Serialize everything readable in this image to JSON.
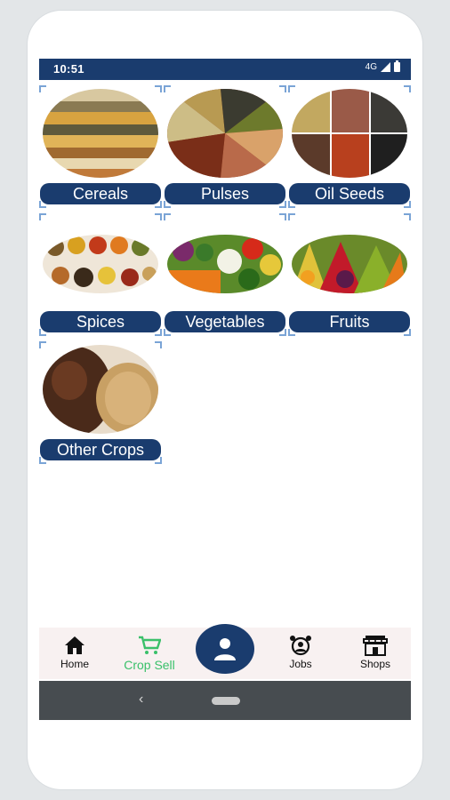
{
  "status": {
    "time": "10:51",
    "network": "4G"
  },
  "categories": [
    {
      "label": "Cereals",
      "image": "cereals-photo"
    },
    {
      "label": "Pulses",
      "image": "pulses-photo"
    },
    {
      "label": "Oil Seeds",
      "image": "oil-seeds-photo"
    },
    {
      "label": "Spices",
      "image": "spices-photo"
    },
    {
      "label": "Vegetables",
      "image": "vegetables-photo"
    },
    {
      "label": "Fruits",
      "image": "fruits-photo"
    },
    {
      "label": "Other Crops",
      "image": "other-crops-photo"
    }
  ],
  "nav": {
    "home": "Home",
    "crop_sell": "Crop Sell",
    "jobs": "Jobs",
    "shops": "Shops",
    "active": "crop_sell"
  },
  "colors": {
    "primary": "#1a3c6e",
    "active": "#3ac06a",
    "nav_bg": "#f8f1f1",
    "system_bar": "#474c50"
  },
  "icons": [
    "home-icon",
    "cart-icon",
    "person-icon",
    "alarm-clock-icon",
    "shop-icon",
    "back-icon"
  ]
}
